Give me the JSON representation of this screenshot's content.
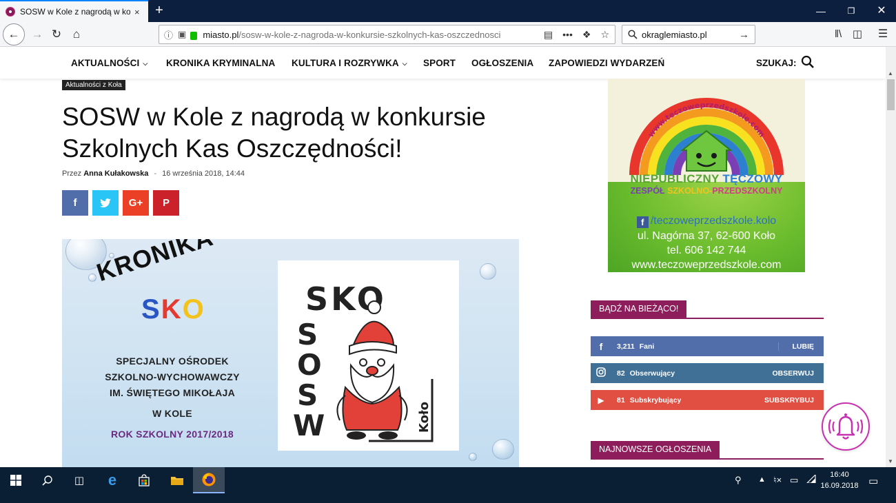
{
  "browser": {
    "tab_title": "SOSW w Kole z nagrodą w konk",
    "tab_close": "×",
    "new_tab": "+",
    "url_host": "miasto.pl",
    "url_path": "/sosw-w-kole-z-nagroda-w-konkursie-szkolnych-kas-oszczednosci",
    "page_actions": "•••",
    "search_value": "okraglemiasto.pl"
  },
  "sitenav": {
    "items": [
      {
        "label": "AKTUALNOŚCI",
        "dropdown": true
      },
      {
        "label": "KRONIKA KRYMINALNA",
        "dropdown": false
      },
      {
        "label": "KULTURA I ROZRYWKA",
        "dropdown": true
      },
      {
        "label": "SPORT",
        "dropdown": false
      },
      {
        "label": "OGŁOSZENIA",
        "dropdown": false
      },
      {
        "label": "ZAPOWIEDZI WYDARZEŃ",
        "dropdown": false
      }
    ],
    "search_label": "SZUKAJ:"
  },
  "article": {
    "category": "Aktualności z Koła",
    "title_line1": "SOSW w Kole z nagrodą w konkursie",
    "title_line2": "Szkolnych Kas Oszczędności!",
    "by": "Przez",
    "author": "Anna Kułakowska",
    "sep": "-",
    "date": "16 września 2018, 14:44",
    "share": {
      "facebook": "f",
      "twitter": "t",
      "google": "G+",
      "pinterest": "P"
    },
    "hero": {
      "kronika": "KRONIKA",
      "sko_s": "S",
      "sko_k": "K",
      "sko_o": "O",
      "line1": "SPECJALNY OŚRODEK",
      "line2": "SZKOLNO-WYCHOWAWCZY",
      "line3": "IM. ŚWIĘTEGO MIKOŁAJA",
      "line4": "W KOLE",
      "line5": "ROK SZKOLNY 2017/2018",
      "drawing_top": "SKO",
      "drawing_side": [
        "S",
        "O",
        "S",
        "W"
      ],
      "drawing_city": "Koło"
    }
  },
  "ad": {
    "arc_text": "www.teczoweprzedszkole.com",
    "name1": "NIEPUBLICZNY",
    "name2": "TĘCZOWY",
    "sub1": "ZESPÓŁ",
    "sub2": "SZKOLNO-",
    "sub3": "PRZEDSZKOLNY",
    "fb": "/teczoweprzedszkole.kolo",
    "address": "ul. Nagórna 37, 62-600 Koło",
    "phone": "tel. 606 142 744",
    "www": "www.teczoweprzedszkole.com"
  },
  "sidebar": {
    "follow_title": "BĄDŹ NA BIEŻĄCO!",
    "social": [
      {
        "count": "3,211",
        "label": "Fani",
        "action": "LUBIĘ"
      },
      {
        "count": "82",
        "label": "Obserwujący",
        "action": "OBSERWUJ"
      },
      {
        "count": "81",
        "label": "Subskrybujący",
        "action": "SUBSKRYBUJ"
      }
    ],
    "ads_title": "NAJNOWSZE OGŁOSZENIA"
  },
  "taskbar": {
    "time": "16:40",
    "date": "16.09.2018"
  },
  "colors": {
    "accent": "#8e1d5b",
    "facebook": "#516eab",
    "instagram": "#417096",
    "youtube": "#e14e42"
  }
}
